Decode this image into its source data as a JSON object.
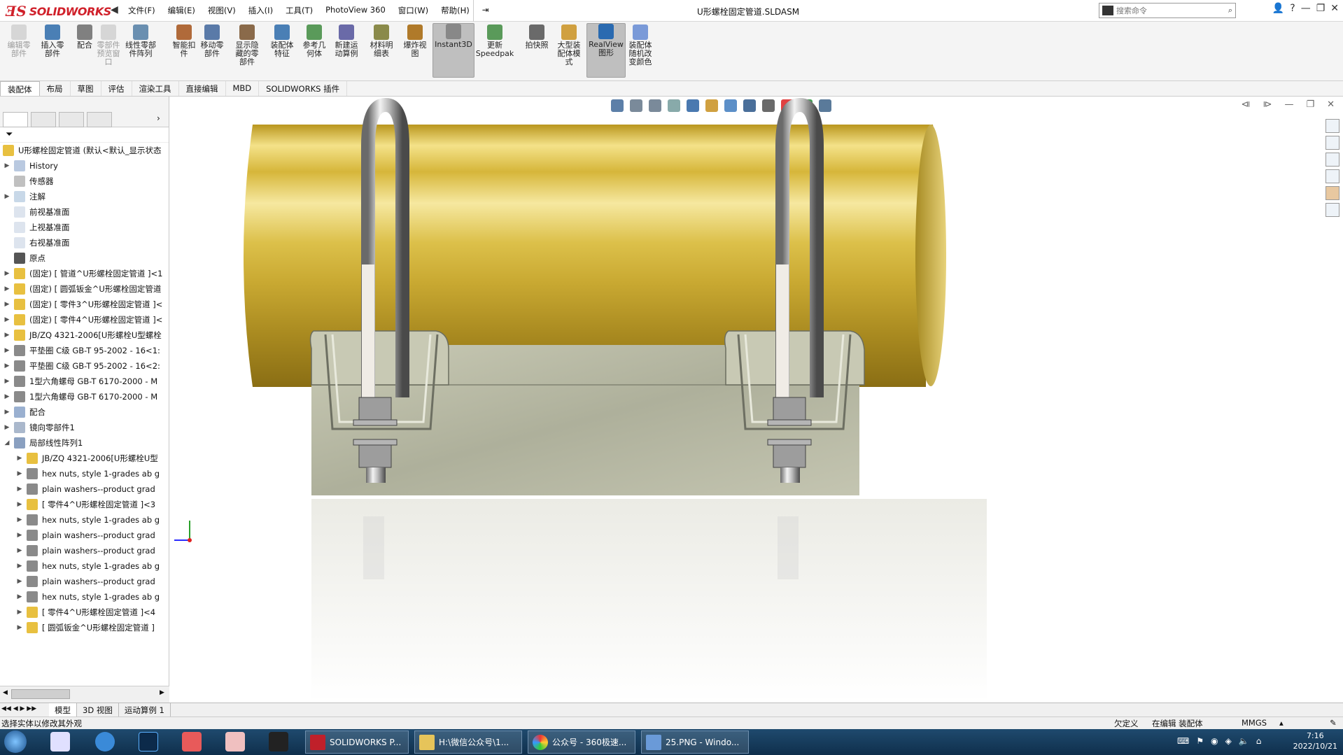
{
  "app": {
    "name": "SOLIDWORKS",
    "window_title": "U形螺栓固定管道.SLDASM"
  },
  "menu": [
    "文件(F)",
    "编辑(E)",
    "视图(V)",
    "插入(I)",
    "工具(T)",
    "PhotoView 360",
    "窗口(W)",
    "帮助(H)"
  ],
  "search": {
    "placeholder": "搜索命令"
  },
  "ribbon": [
    {
      "label": "编辑零\n部件",
      "icon": "edit-component-icon",
      "disabled": true
    },
    {
      "label": "插入零\n部件",
      "icon": "insert-component-icon"
    },
    {
      "label": "配合",
      "icon": "mate-icon"
    },
    {
      "label": "零部件\n预览窗\n口",
      "icon": "preview-window-icon",
      "disabled": true
    },
    {
      "label": "线性零部\n件阵列",
      "icon": "linear-pattern-icon"
    },
    {
      "label": "智能扣\n件",
      "icon": "smart-fastener-icon"
    },
    {
      "label": "移动零\n部件",
      "icon": "move-component-icon"
    },
    {
      "label": "显示隐\n藏的零\n部件",
      "icon": "show-hidden-icon"
    },
    {
      "label": "装配体\n特征",
      "icon": "assembly-feature-icon"
    },
    {
      "label": "参考几\n何体",
      "icon": "reference-geometry-icon"
    },
    {
      "label": "新建运\n动算例",
      "icon": "motion-study-icon"
    },
    {
      "label": "材料明\n细表",
      "icon": "bom-icon"
    },
    {
      "label": "爆炸视\n图",
      "icon": "exploded-view-icon"
    },
    {
      "label": "Instant3D",
      "icon": "instant3d-icon",
      "active": true
    },
    {
      "label": "更新\nSpeedpak",
      "icon": "speedpak-icon"
    },
    {
      "label": "拍快照",
      "icon": "snapshot-icon"
    },
    {
      "label": "大型装\n配体模\n式",
      "icon": "large-assembly-icon"
    },
    {
      "label": "RealView\n图形",
      "icon": "realview-icon",
      "active": true
    },
    {
      "label": "装配体\n随机改\n变颜色",
      "icon": "random-color-icon"
    }
  ],
  "command_tabs": [
    "装配体",
    "布局",
    "草图",
    "评估",
    "渲染工具",
    "直接编辑",
    "MBD",
    "SOLIDWORKS 插件"
  ],
  "tree": {
    "root": "U形螺栓固定管道  (默认<默认_显示状态",
    "items": [
      {
        "label": "History",
        "icon": "history-icon",
        "level": 1,
        "expand": true
      },
      {
        "label": "传感器",
        "icon": "sensor-icon",
        "level": 1
      },
      {
        "label": "注解",
        "icon": "annotation-icon",
        "level": 1,
        "expand": true
      },
      {
        "label": "前视基准面",
        "icon": "plane-icon",
        "level": 1
      },
      {
        "label": "上视基准面",
        "icon": "plane-icon",
        "level": 1
      },
      {
        "label": "右视基准面",
        "icon": "plane-icon",
        "level": 1
      },
      {
        "label": "原点",
        "icon": "origin-icon",
        "level": 1
      },
      {
        "label": "(固定) [ 管道^U形螺栓固定管道 ]<1",
        "icon": "part-icon",
        "level": 1,
        "expand": true
      },
      {
        "label": "(固定) [ 圆弧钣金^U形螺栓固定管道",
        "icon": "part-icon",
        "level": 1,
        "expand": true
      },
      {
        "label": "(固定) [ 零件3^U形螺栓固定管道 ]<",
        "icon": "part-icon",
        "level": 1,
        "expand": true
      },
      {
        "label": "(固定) [ 零件4^U形螺栓固定管道 ]<",
        "icon": "part-icon",
        "level": 1,
        "expand": true
      },
      {
        "label": "JB/ZQ 4321-2006[U形螺栓U型螺栓",
        "icon": "part-icon",
        "level": 1,
        "expand": true
      },
      {
        "label": "平垫圈 C级 GB-T 95-2002 - 16<1:",
        "icon": "toolbox-icon",
        "level": 1,
        "expand": true
      },
      {
        "label": "平垫圈 C级 GB-T 95-2002 - 16<2:",
        "icon": "toolbox-icon",
        "level": 1,
        "expand": true
      },
      {
        "label": "1型六角螺母 GB-T 6170-2000 - M",
        "icon": "toolbox-icon",
        "level": 1,
        "expand": true
      },
      {
        "label": "1型六角螺母 GB-T 6170-2000 - M",
        "icon": "toolbox-icon",
        "level": 1,
        "expand": true
      },
      {
        "label": "配合",
        "icon": "mates-icon",
        "level": 1,
        "expand": true
      },
      {
        "label": "镜向零部件1",
        "icon": "mirror-icon",
        "level": 1,
        "expand": true
      },
      {
        "label": "局部线性阵列1",
        "icon": "pattern-icon",
        "level": 1,
        "open": true
      },
      {
        "label": "JB/ZQ 4321-2006[U形螺栓U型",
        "icon": "part-icon",
        "level": 2,
        "expand": true
      },
      {
        "label": "hex nuts, style 1-grades ab g",
        "icon": "toolbox-icon",
        "level": 2,
        "expand": true
      },
      {
        "label": "plain washers--product grad",
        "icon": "toolbox-icon",
        "level": 2,
        "expand": true
      },
      {
        "label": "[ 零件4^U形螺栓固定管道 ]<3",
        "icon": "part-icon",
        "level": 2,
        "expand": true
      },
      {
        "label": "hex nuts, style 1-grades ab g",
        "icon": "toolbox-icon",
        "level": 2,
        "expand": true
      },
      {
        "label": "plain washers--product grad",
        "icon": "toolbox-icon",
        "level": 2,
        "expand": true
      },
      {
        "label": "plain washers--product grad",
        "icon": "toolbox-icon",
        "level": 2,
        "expand": true
      },
      {
        "label": "hex nuts, style 1-grades ab g",
        "icon": "toolbox-icon",
        "level": 2,
        "expand": true
      },
      {
        "label": "plain washers--product grad",
        "icon": "toolbox-icon",
        "level": 2,
        "expand": true
      },
      {
        "label": "hex nuts, style 1-grades ab g",
        "icon": "toolbox-icon",
        "level": 2,
        "expand": true
      },
      {
        "label": "[ 零件4^U形螺栓固定管道 ]<4",
        "icon": "part-icon",
        "level": 2,
        "expand": true
      },
      {
        "label": "[ 圆弧钣金^U形螺栓固定管道 ]",
        "icon": "part-icon",
        "level": 2,
        "expand": true
      }
    ]
  },
  "bottom_tabs": [
    "模型",
    "3D 视图",
    "运动算例 1"
  ],
  "status": {
    "left": "选择实体以修改其外观",
    "under_defined": "欠定义",
    "editing": "在编辑 装配体",
    "units": "MMGS"
  },
  "taskbar": {
    "items": [
      "SOLIDWORKS P...",
      "H:\\微信公众号\\1...",
      "公众号 - 360极速...",
      "25.PNG - Windo..."
    ],
    "time": "7:16",
    "date": "2022/10/21"
  },
  "colors": {
    "accent": "#d0202a",
    "pipe": "#d4b23a",
    "bracket": "#bdbfa9",
    "bolt": "#c8c8c8"
  }
}
